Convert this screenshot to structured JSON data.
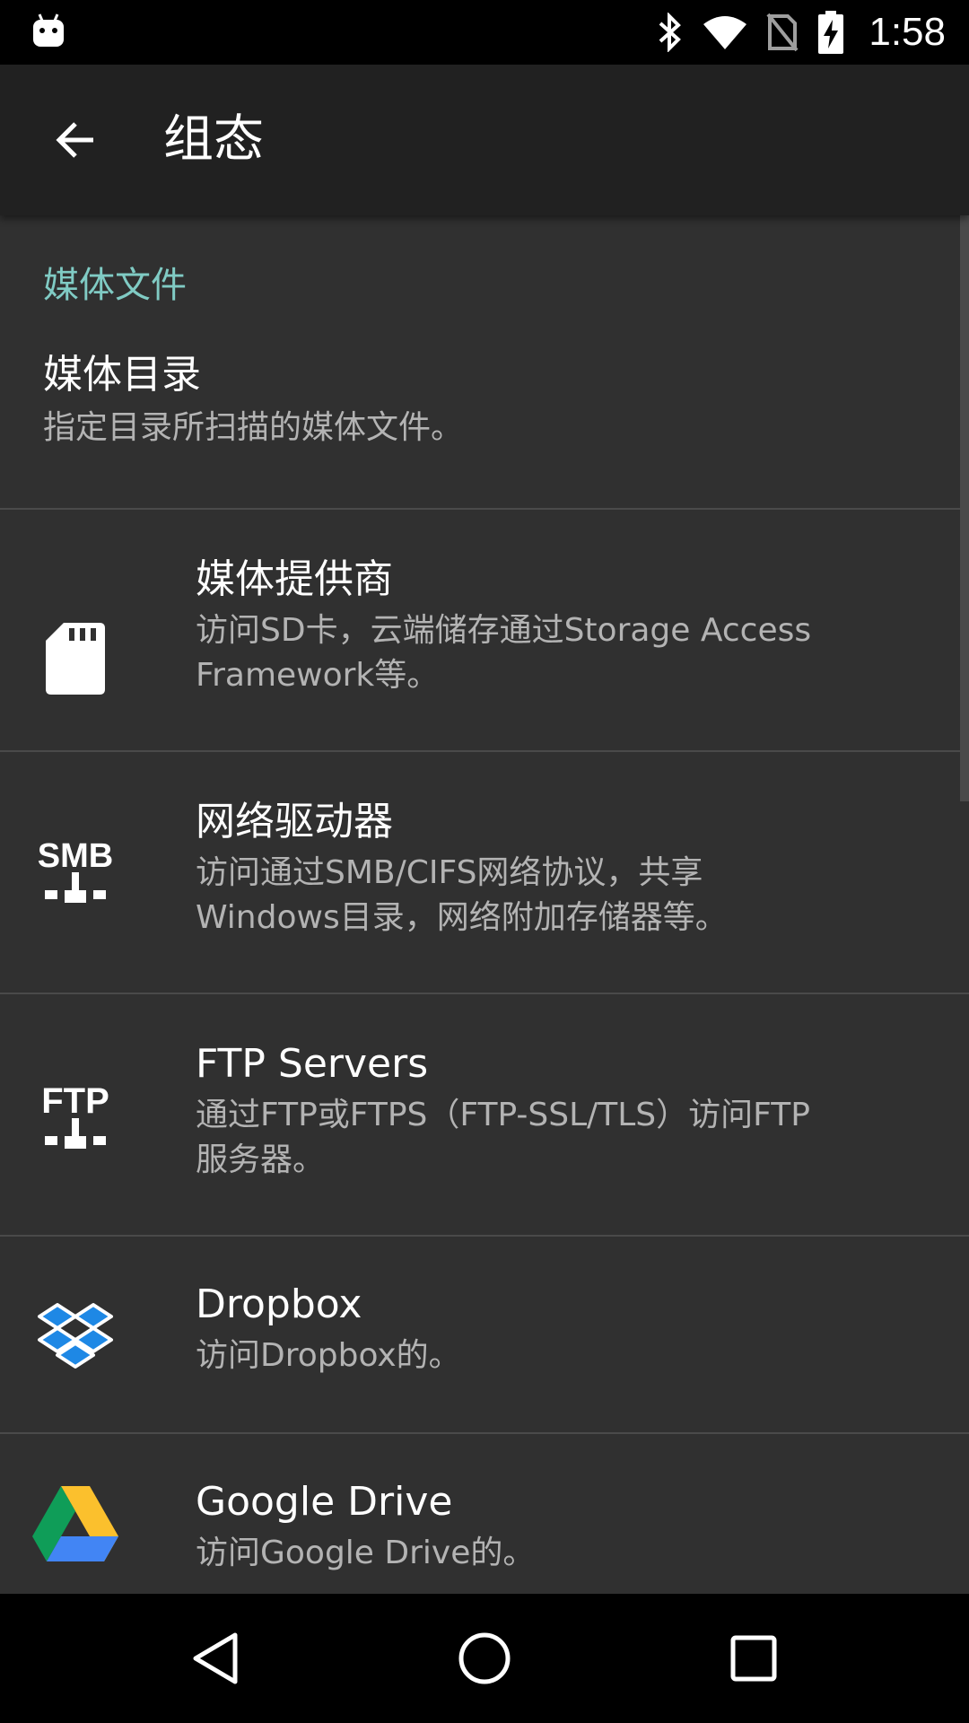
{
  "status_bar": {
    "time": "1:58",
    "icons": [
      "android-debug-icon",
      "bluetooth-icon",
      "wifi-icon",
      "no-sim-icon",
      "battery-charging-icon"
    ]
  },
  "app_bar": {
    "title": "组态",
    "back_icon": "arrow-back-icon"
  },
  "section": {
    "header": "媒体文件"
  },
  "items": [
    {
      "title": "媒体目录",
      "desc": "指定目录所扫描的媒体文件。",
      "icon": ""
    },
    {
      "title": "媒体提供商",
      "desc_line1": "访问SD卡，云端储存通过Storage Access",
      "desc_line2": "Framework等。",
      "icon": "sd-card-icon"
    },
    {
      "title": "网络驱动器",
      "desc_line1": "访问通过SMB/CIFS网络协议，共享",
      "desc_line2": "Windows目录，网络附加存储器等。",
      "icon": "smb-network-icon",
      "icon_label": "SMB"
    },
    {
      "title": "FTP Servers",
      "desc_line1": "通过FTP或FTPS（FTP-SSL/TLS）访问FTP",
      "desc_line2": "服务器。",
      "icon": "ftp-network-icon",
      "icon_label": "FTP"
    },
    {
      "title": "Dropbox",
      "desc": "访问Dropbox的。",
      "icon": "dropbox-icon"
    },
    {
      "title": "Google Drive",
      "desc": "访问Google Drive的。",
      "icon": "google-drive-icon"
    }
  ],
  "nav_bar": {
    "icons": [
      "back-triangle-icon",
      "home-circle-icon",
      "recents-square-icon"
    ]
  },
  "colors": {
    "accent": "#80cbc4",
    "background": "#303030",
    "app_bar": "#212121"
  }
}
